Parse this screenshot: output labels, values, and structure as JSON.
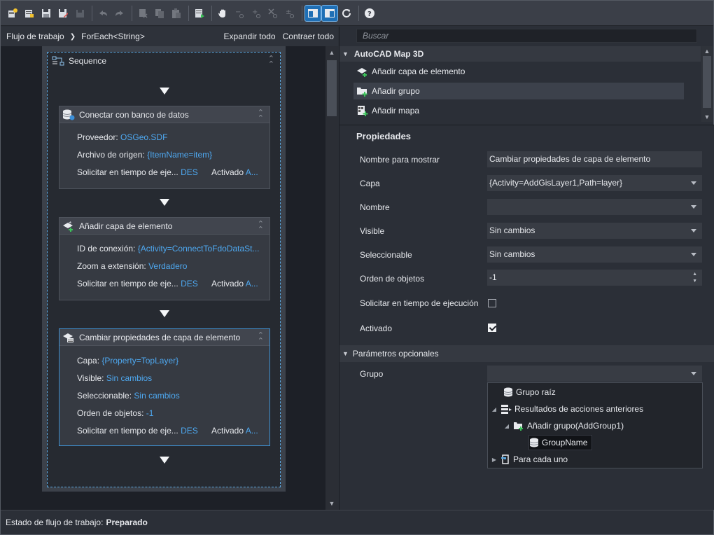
{
  "toolbar": {
    "icons": [
      "new-workflow-icon",
      "open-icon",
      "save-icon",
      "save-as-icon",
      "save-all-icon",
      "undo-icon",
      "redo-icon",
      "cut-icon",
      "copy-icon",
      "paste-icon",
      "run-icon",
      "pan-icon",
      "zoom-out-icon",
      "zoom-in-icon",
      "zoom-reset-icon",
      "zoom-fit-icon",
      "layout-toolbox-icon",
      "layout-properties-icon",
      "refresh-icon",
      "help-icon"
    ]
  },
  "workflow": {
    "breadcrumb": [
      "Flujo de trabajo",
      "ForEach<String>"
    ],
    "expand_all": "Expandir todo",
    "collapse_all": "Contraer todo",
    "sequence_title": "Sequence",
    "activities": [
      {
        "title": "Conectar con banco de datos",
        "rows": [
          {
            "label": "Proveedor:",
            "value": "OSGeo.SDF"
          },
          {
            "label": "Archivo de origen:",
            "value": "{ItemName=item}"
          },
          {
            "label": "Solicitar en tiempo de eje...",
            "value": "DES",
            "label2": "Activado",
            "value2": "A..."
          }
        ]
      },
      {
        "title": "Añadir capa de elemento",
        "rows": [
          {
            "label": "ID de conexión:",
            "value": "{Activity=ConnectToFdoDataSt..."
          },
          {
            "label": "Zoom a extensión:",
            "value": "Verdadero"
          },
          {
            "label": "Solicitar en tiempo de eje...",
            "value": "DES",
            "label2": "Activado",
            "value2": "A..."
          }
        ]
      },
      {
        "title": "Cambiar propiedades de capa de elemento",
        "rows": [
          {
            "label": "Capa:",
            "value": "{Property=TopLayer}"
          },
          {
            "label": "Visible:",
            "value": "Sin cambios"
          },
          {
            "label": "Seleccionable:",
            "value": "Sin cambios"
          },
          {
            "label": "Orden de objetos:",
            "value": "-1"
          },
          {
            "label": "Solicitar en tiempo de eje...",
            "value": "DES",
            "label2": "Activado",
            "value2": "A..."
          }
        ]
      }
    ]
  },
  "toolbox": {
    "search_placeholder": "Buscar",
    "category": "AutoCAD Map 3D",
    "items": [
      "Añadir capa de elemento",
      "Añadir grupo",
      "Añadir mapa"
    ]
  },
  "properties": {
    "title": "Propiedades",
    "rows": [
      {
        "label": "Nombre para mostrar",
        "value": "Cambiar propiedades de capa de elemento"
      },
      {
        "label": "Capa",
        "value": "{Activity=AddGisLayer1,Path=layer}"
      },
      {
        "label": "Nombre",
        "value": ""
      },
      {
        "label": "Visible",
        "value": "Sin cambios"
      },
      {
        "label": "Seleccionable",
        "value": "Sin cambios"
      },
      {
        "label": "Orden de objetos",
        "value": "-1"
      },
      {
        "label": "Solicitar en tiempo de ejecución",
        "checked": false
      },
      {
        "label": "Activado",
        "checked": true
      }
    ],
    "optional_title": "Parámetros opcionales",
    "group_label": "Grupo",
    "group_value": "",
    "tree": [
      {
        "label": "Grupo raíz"
      },
      {
        "label": "Resultados de acciones anteriores"
      },
      {
        "label": "Añadir grupo(AddGroup1)"
      },
      {
        "label": "GroupName"
      },
      {
        "label": "Para cada uno"
      }
    ]
  },
  "status": {
    "label": "Estado de flujo de trabajo:",
    "value": "Preparado"
  }
}
